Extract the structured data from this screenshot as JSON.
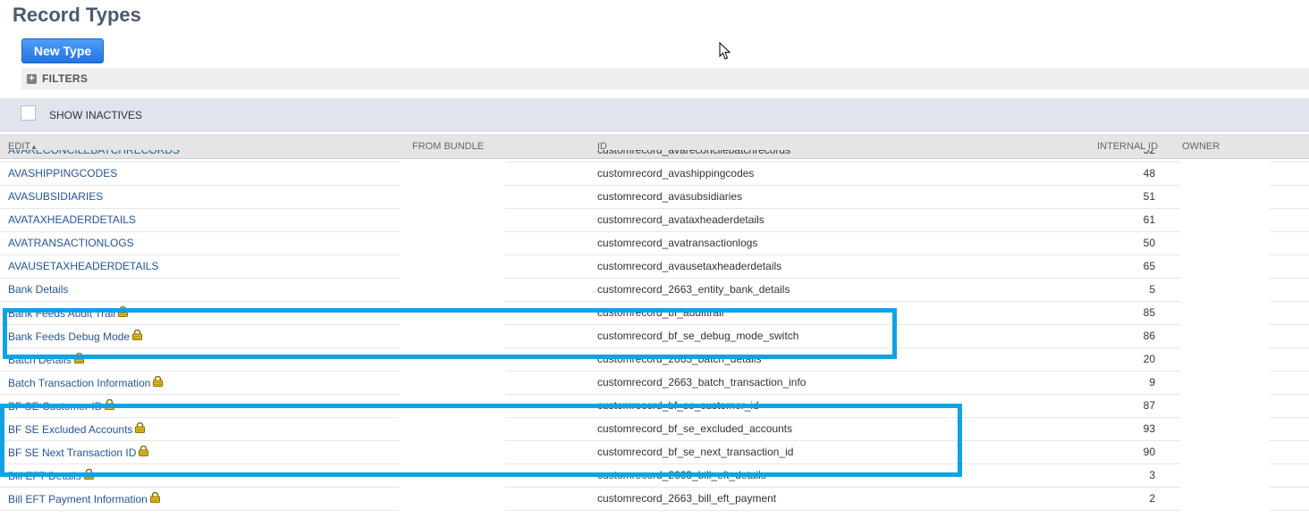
{
  "page": {
    "title": "Record Types",
    "new_button": "New Type",
    "filters_label": "FILTERS",
    "show_inactives_label": "SHOW INACTIVES"
  },
  "table": {
    "headers": {
      "edit": "EDIT",
      "sort_indicator": "▲",
      "from_bundle": "FROM BUNDLE",
      "id": "ID",
      "internal_id": "INTERNAL ID",
      "owner": "OWNER"
    },
    "rows": [
      {
        "name": "AVARECONCILEBATCHRECORDS",
        "id": "customrecord_avareconcilebatchrecords",
        "internal_id": "52",
        "locked": false
      },
      {
        "name": "AVASHIPPINGCODES",
        "id": "customrecord_avashippingcodes",
        "internal_id": "48",
        "locked": false
      },
      {
        "name": "AVASUBSIDIARIES",
        "id": "customrecord_avasubsidiaries",
        "internal_id": "51",
        "locked": false
      },
      {
        "name": "AVATAXHEADERDETAILS",
        "id": "customrecord_avataxheaderdetails",
        "internal_id": "61",
        "locked": false
      },
      {
        "name": "AVATRANSACTIONLOGS",
        "id": "customrecord_avatransactionlogs",
        "internal_id": "50",
        "locked": false
      },
      {
        "name": "AVAUSETAXHEADERDETAILS",
        "id": "customrecord_avausetaxheaderdetails",
        "internal_id": "65",
        "locked": false
      },
      {
        "name": "Bank Details",
        "id": "customrecord_2663_entity_bank_details",
        "internal_id": "5",
        "locked": false
      },
      {
        "name": "Bank Feeds Audit Trail",
        "id": "customrecord_bf_audittrail",
        "internal_id": "85",
        "locked": true
      },
      {
        "name": "Bank Feeds Debug Mode",
        "id": "customrecord_bf_se_debug_mode_switch",
        "internal_id": "86",
        "locked": true
      },
      {
        "name": "Batch Details",
        "id": "customrecord_2663_batch_details",
        "internal_id": "20",
        "locked": true
      },
      {
        "name": "Batch Transaction Information",
        "id": "customrecord_2663_batch_transaction_info",
        "internal_id": "9",
        "locked": true
      },
      {
        "name": "BF SE Customer ID",
        "id": "customrecord_bf_se_customer_id",
        "internal_id": "87",
        "locked": true
      },
      {
        "name": "BF SE Excluded Accounts",
        "id": "customrecord_bf_se_excluded_accounts",
        "internal_id": "93",
        "locked": true
      },
      {
        "name": "BF SE Next Transaction ID",
        "id": "customrecord_bf_se_next_transaction_id",
        "internal_id": "90",
        "locked": true
      },
      {
        "name": "Bill EFT Details",
        "id": "customrecord_2663_bill_eft_details",
        "internal_id": "3",
        "locked": true
      },
      {
        "name": "Bill EFT Payment Information",
        "id": "customrecord_2663_bill_eft_payment",
        "internal_id": "2",
        "locked": true
      }
    ]
  },
  "colors": {
    "link": "#255599",
    "highlight": "#0fa2e5",
    "button": "#2473e4"
  },
  "icons": {
    "lock": "lock-icon",
    "filters_toggle": "plus-icon",
    "cursor": "mouse-cursor-icon"
  }
}
